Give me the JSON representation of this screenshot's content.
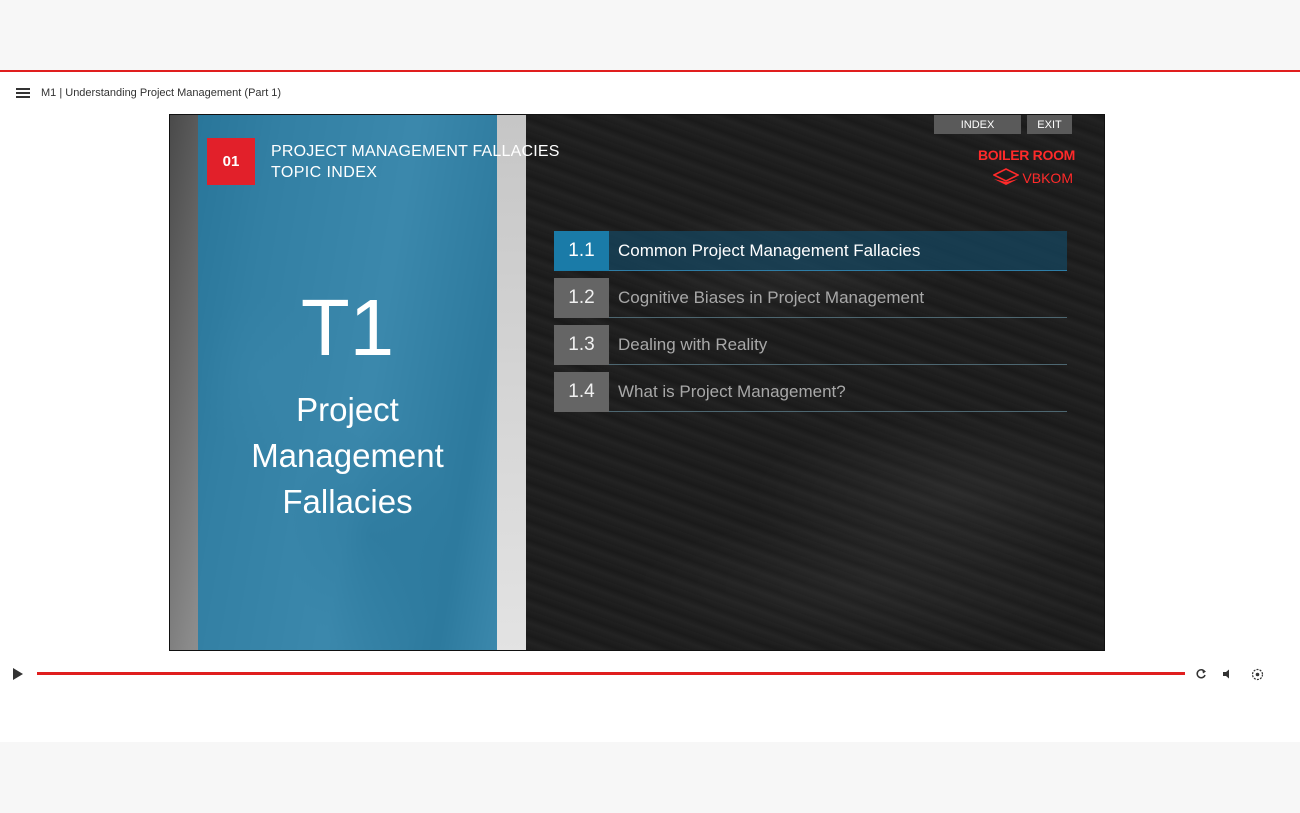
{
  "player": {
    "course_title": "M1 | Understanding Project Management (Part 1)"
  },
  "slide": {
    "badge": "01",
    "heading_line1": "PROJECT MANAGEMENT FALLACIES",
    "heading_line2": "TOPIC INDEX",
    "big_label": "T1",
    "topic_title_lines": [
      "Project",
      "Management",
      "Fallacies"
    ],
    "buttons": {
      "index": "INDEX",
      "exit": "EXIT"
    },
    "logos": {
      "primary": "BOILER ROOM",
      "secondary": "VBKOM"
    },
    "menu_items": [
      {
        "number": "1.1",
        "label": "Common Project Management Fallacies",
        "active": true
      },
      {
        "number": "1.2",
        "label": "Cognitive Biases in Project Management",
        "active": false
      },
      {
        "number": "1.3",
        "label": "Dealing with Reality",
        "active": false
      },
      {
        "number": "1.4",
        "label": "What is Project Management?",
        "active": false
      }
    ]
  },
  "controls": {
    "icons": [
      "play-icon",
      "replay-icon",
      "volume-icon",
      "settings-icon"
    ]
  },
  "colors": {
    "accent": "#e01e1e",
    "panel_blue": "#1d7daa",
    "badge_red": "#e2202a",
    "active_item": "#1a7ba8"
  }
}
